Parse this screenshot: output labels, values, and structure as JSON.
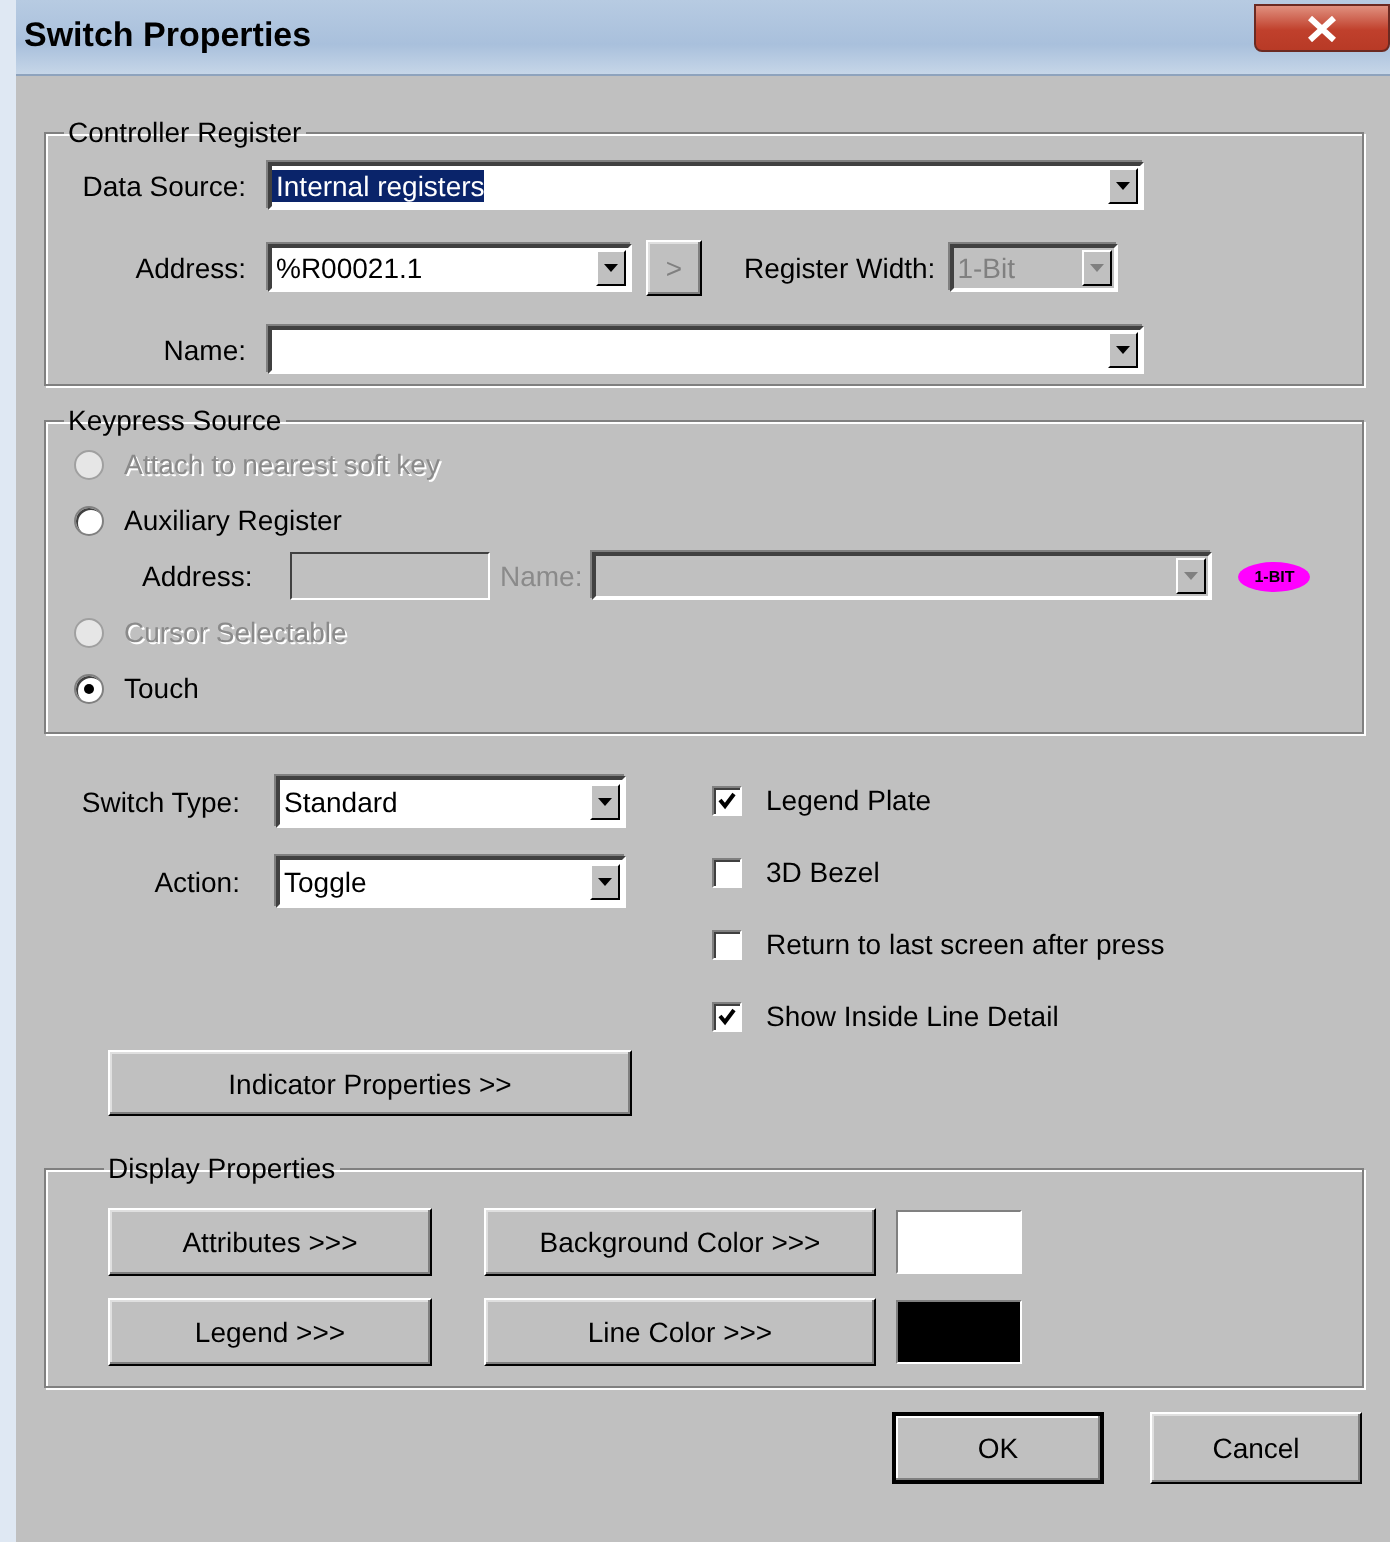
{
  "window": {
    "title": "Switch Properties"
  },
  "controller_register": {
    "title": "Controller Register",
    "data_source": {
      "label": "Data Source:",
      "value": "Internal registers",
      "text_selected": true
    },
    "address": {
      "label": "Address:",
      "value": "%R00021.1",
      "next_button": ">",
      "next_disabled": true
    },
    "register_width": {
      "label": "Register Width:",
      "value": "1-Bit",
      "disabled": true
    },
    "name": {
      "label": "Name:"
    }
  },
  "keypress_source": {
    "title": "Keypress Source",
    "options": [
      {
        "label": "Attach to nearest soft key",
        "selected": false,
        "disabled": true
      },
      {
        "label": "Auxiliary Register",
        "selected": false,
        "disabled": false,
        "fields": {
          "address_label": "Address:",
          "name_label": "Name:",
          "disabled": true,
          "badge": "1-BIT"
        }
      },
      {
        "label": "Cursor Selectable",
        "selected": false,
        "disabled": true
      },
      {
        "label": "Touch",
        "selected": true,
        "disabled": false
      }
    ]
  },
  "switch": {
    "type": {
      "label": "Switch Type:",
      "value": "Standard"
    },
    "action": {
      "label": "Action:",
      "value": "Toggle"
    },
    "indicator_button": "Indicator Properties >>"
  },
  "options": [
    {
      "label": "Legend Plate",
      "checked": true
    },
    {
      "label": "3D Bezel",
      "checked": false
    },
    {
      "label": "Return to last screen after press",
      "checked": false
    },
    {
      "label": "Show Inside Line Detail",
      "checked": true
    }
  ],
  "display_properties": {
    "title": "Display Properties",
    "rows": [
      {
        "button": "Attributes >>>",
        "color_button": "Background Color >>>",
        "color": "#ffffff"
      },
      {
        "button": "Legend >>>",
        "color_button": "Line Color >>>",
        "color": "#000000"
      }
    ]
  },
  "buttons": [
    {
      "label": "OK",
      "default": true
    },
    {
      "label": "Cancel",
      "default": false
    }
  ]
}
